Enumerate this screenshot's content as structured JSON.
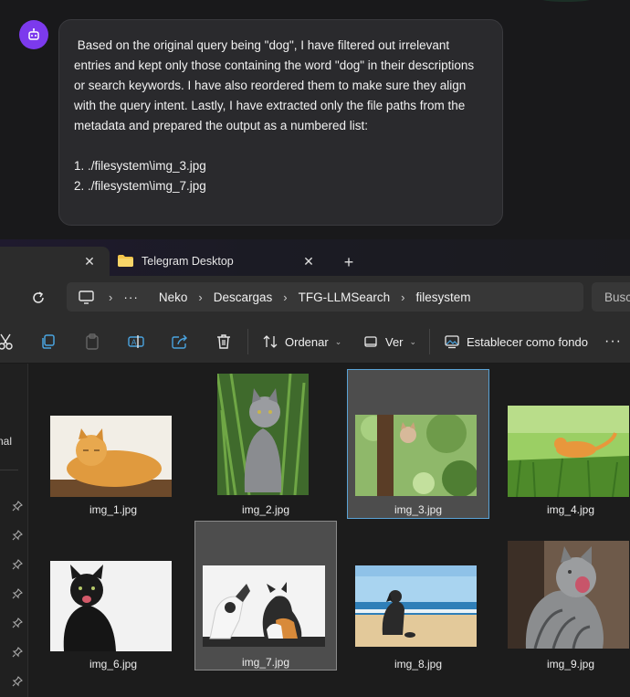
{
  "chat": {
    "message": " Based on the original query being \"dog\", I have filtered out irrelevant entries and kept only those containing the word \"dog\" in their descriptions or search keywords. I have also reordered them to make sure they align with the query intent. Lastly, I have extracted only the file paths from the metadata and prepared the output as a numbered list:",
    "list": [
      "1. ./filesystem\\img_3.jpg",
      "2. ./filesystem\\img_7.jpg"
    ],
    "avatar_icon": "robot-icon",
    "avatar_color": "#7c3aed"
  },
  "explorer": {
    "tabs": [
      {
        "label": ""
      },
      {
        "label": "Telegram Desktop"
      }
    ],
    "breadcrumb": [
      "Neko",
      "Descargas",
      "TFG-LLMSearch",
      "filesystem"
    ],
    "search_placeholder": "Busc",
    "toolbar": {
      "sort_label": "Ordenar",
      "view_label": "Ver",
      "wallpaper_label": "Establecer como fondo"
    },
    "nav_partial_label": "nal",
    "files": [
      {
        "name": "img_1.jpg"
      },
      {
        "name": "img_2.jpg"
      },
      {
        "name": "img_3.jpg"
      },
      {
        "name": "img_4.jpg"
      },
      {
        "name": "img_6.jpg"
      },
      {
        "name": "img_7.jpg"
      },
      {
        "name": "img_8.jpg"
      },
      {
        "name": "img_9.jpg"
      }
    ],
    "selection_color": "#5aa3d6"
  }
}
